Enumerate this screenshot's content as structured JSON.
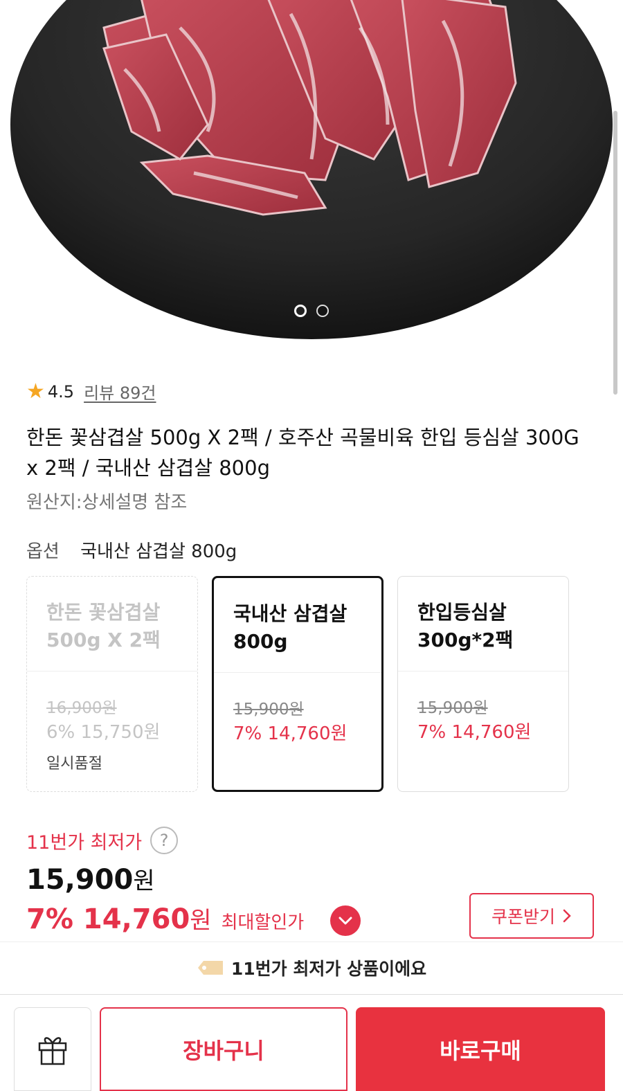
{
  "rating": {
    "score": "4.5",
    "review_link": "리뷰 89건"
  },
  "product": {
    "title": "한돈 꽃삼겹살 500g X 2팩 / 호주산 곡물비육 한입 등심살 300G x 2팩 / 국내산 삼겹살 800g",
    "origin": "원산지:상세설명 참조"
  },
  "option": {
    "label": "옵션",
    "selected_value": "국내산 삼겹살 800g"
  },
  "cards": [
    {
      "name": "한돈 꽃삼겹살 500g X 2팩",
      "orig_price": "16,900원",
      "sale_price": "6% 15,750원",
      "status": "일시품절"
    },
    {
      "name": "국내산 삼겹살 800g",
      "orig_price": "15,900원",
      "sale_price": "7% 14,760원"
    },
    {
      "name": "한입등심살 300g*2팩",
      "orig_price": "15,900원",
      "sale_price": "7% 14,760원"
    }
  ],
  "price": {
    "lowest_label": "11번가 최저가",
    "help": "?",
    "original_amount": "15,900",
    "won": "원",
    "discount_pct": "7%",
    "sale_amount": "14,760",
    "max_discount_label": "최대할인가"
  },
  "coupon": {
    "label": "쿠폰받기"
  },
  "banner": {
    "text": "11번가 최저가 상품이에요"
  },
  "bottom": {
    "cart_label": "장바구니",
    "buy_label": "바로구매"
  },
  "colors": {
    "accent": "#e4324a",
    "buy_bg": "#e8323f",
    "star": "#f5a623"
  },
  "icons": [
    "star-icon",
    "question-icon",
    "chevron-down-icon",
    "chevron-right-icon",
    "tag-icon",
    "gift-icon"
  ]
}
